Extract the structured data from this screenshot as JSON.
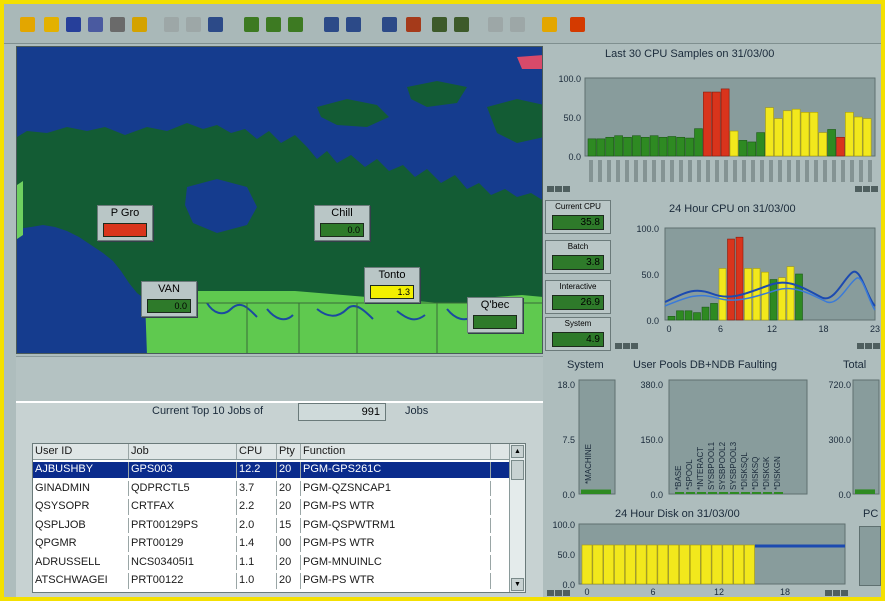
{
  "toolbar": {
    "buttons": [
      {
        "name": "open-folder-icon",
        "color": "#e3a600"
      },
      {
        "name": "folder-icon",
        "color": "#e3b100"
      },
      {
        "name": "save-icon",
        "color": "#263f9a"
      },
      {
        "name": "save-as-icon",
        "color": "#4a5aa0"
      },
      {
        "name": "print-icon",
        "color": "#6a6a6a"
      },
      {
        "name": "exit-door-icon",
        "color": "#d4a200"
      },
      {
        "name": "cut-icon",
        "color": "#888",
        "disabled": true
      },
      {
        "name": "copy-icon",
        "color": "#888",
        "disabled": true
      },
      {
        "name": "paste-icon",
        "color": "#2c4a88"
      },
      {
        "name": "table-icon",
        "color": "#3d7a22"
      },
      {
        "name": "grid-icon",
        "color": "#3d7a22"
      },
      {
        "name": "sheet-icon",
        "color": "#3d7a22"
      },
      {
        "name": "bar-chart-icon",
        "color": "#2c4a88"
      },
      {
        "name": "bar-chart-2-icon",
        "color": "#2c4a88"
      },
      {
        "name": "monitor-icon",
        "color": "#2c4a88"
      },
      {
        "name": "alarm-icon",
        "color": "#a53a1a"
      },
      {
        "name": "document-icon",
        "color": "#3d5a2a"
      },
      {
        "name": "windows-icon",
        "color": "#3d5a2a"
      },
      {
        "name": "tile-icon",
        "color": "#888",
        "disabled": true
      },
      {
        "name": "cascade-icon",
        "color": "#888",
        "disabled": true
      },
      {
        "name": "help-icon",
        "color": "#e3a600"
      },
      {
        "name": "info-icon",
        "color": "#d43a00"
      }
    ]
  },
  "map": {
    "locations": [
      {
        "name": "P Gro",
        "value": "",
        "color": "#d9341c"
      },
      {
        "name": "Chill",
        "value": "0.0",
        "color": "#2e7a2a"
      },
      {
        "name": "VAN",
        "value": "0.0",
        "color": "#2e7a2a"
      },
      {
        "name": "Tonto",
        "value": "1.3",
        "color": "#f2f000"
      },
      {
        "name": "Q'bec",
        "value": "",
        "color": "#2e7a2a"
      }
    ]
  },
  "jobs": {
    "count_label": "Current Top 10 Jobs of",
    "count_value": "991",
    "count_suffix": "Jobs",
    "columns": [
      "User ID",
      "Job",
      "CPU",
      "Pty",
      "Function"
    ],
    "rows": [
      [
        "AJBUSHBY",
        "GPS003",
        "12.2",
        "20",
        "PGM-GPS261C"
      ],
      [
        "GINADMIN",
        "QDPRCTL5",
        "3.7",
        "20",
        "PGM-QZSNCAP1"
      ],
      [
        "QSYSOPR",
        "CRTFAX",
        "2.2",
        "20",
        "PGM-PS  WTR"
      ],
      [
        "QSPLJOB",
        "PRT00129PS",
        "2.0",
        "15",
        "PGM-QSPWTRM1"
      ],
      [
        "QPGMR",
        "PRT00129",
        "1.4",
        "00",
        "PGM-PS  WTR"
      ],
      [
        "ADRUSSELL",
        "NCS03405I1",
        "1.1",
        "20",
        "PGM-MNUINLC"
      ],
      [
        "ATSCHWAGEI",
        "PRT00122",
        "1.0",
        "20",
        "PGM-PS  WTR"
      ]
    ]
  },
  "stats": [
    {
      "name": "Current CPU",
      "value": "35.8"
    },
    {
      "name": "Batch",
      "value": "3.8"
    },
    {
      "name": "Interactive",
      "value": "26.9"
    },
    {
      "name": "System",
      "value": "4.9"
    }
  ],
  "panels": {
    "cpu30_title": "Last 30 CPU Samples on 31/03/00",
    "cpu24_title": "24 Hour CPU on 31/03/00",
    "system_title": "System",
    "pools_title": "User Pools DB+NDB Faulting",
    "total_title": "Total",
    "disk_title": "24 Hour Disk on 31/03/00",
    "pc_title": "PC",
    "system_bar_label": "*MACHINE",
    "pool_labels": [
      "*BASE",
      "*SPOOL",
      "*INTERACT",
      "SYSBPOOL1",
      "SYSBPOOL2",
      "SYSBPOOL3",
      "*DISKSQL",
      "*DISKSQ",
      "*DISKGK",
      "*DISKGN"
    ]
  },
  "chart_data": [
    {
      "type": "bar",
      "title": "Last 30 CPU Samples on 31/03/00",
      "ylim": [
        0,
        100
      ],
      "y_ticks": [
        "100.0",
        "50.0",
        "0.0"
      ],
      "values": [
        22,
        22,
        24,
        26,
        24,
        26,
        24,
        26,
        24,
        25,
        24,
        23,
        35,
        82,
        82,
        86,
        32,
        20,
        18,
        30,
        62,
        48,
        58,
        60,
        56,
        56,
        30,
        34,
        24,
        56,
        50,
        48
      ],
      "colors": [
        "g",
        "g",
        "g",
        "g",
        "g",
        "g",
        "g",
        "g",
        "g",
        "g",
        "g",
        "g",
        "g",
        "r",
        "r",
        "r",
        "y",
        "g",
        "g",
        "g",
        "y",
        "y",
        "y",
        "y",
        "y",
        "y",
        "y",
        "g",
        "r",
        "y",
        "y",
        "y"
      ]
    },
    {
      "type": "bar",
      "title": "24 Hour CPU on 31/03/00",
      "ylim": [
        0,
        100
      ],
      "y_ticks": [
        "100.0",
        "50.0",
        "0.0"
      ],
      "x_ticks": [
        "0",
        "6",
        "12",
        "18",
        "23"
      ],
      "values": [
        4,
        10,
        10,
        8,
        14,
        18,
        56,
        88,
        90,
        56,
        56,
        52,
        44,
        46,
        58,
        50,
        0,
        0,
        0,
        0,
        0,
        0,
        0,
        0
      ],
      "colors": [
        "g",
        "g",
        "g",
        "g",
        "g",
        "g",
        "y",
        "r",
        "r",
        "y",
        "y",
        "y",
        "g",
        "y",
        "y",
        "g",
        "g",
        "g",
        "g",
        "g",
        "g",
        "g",
        "g",
        "g"
      ]
    },
    {
      "type": "bar",
      "title": "System",
      "ylim": [
        0,
        18
      ],
      "y_ticks": [
        "18.0",
        "7.5",
        "0.0"
      ],
      "values": [
        0.4
      ]
    },
    {
      "type": "bar",
      "title": "User Pools DB+NDB Faulting",
      "ylim": [
        0,
        380
      ],
      "y_ticks": [
        "380.0",
        "150.0",
        "0.0"
      ],
      "values": [
        0,
        0,
        0,
        0,
        0,
        0,
        0,
        0,
        0,
        0
      ]
    },
    {
      "type": "bar",
      "title": "Total",
      "ylim": [
        0,
        720
      ],
      "y_ticks": [
        "720.0",
        "300.0",
        "0.0"
      ],
      "values": [
        30
      ]
    },
    {
      "type": "bar",
      "title": "24 Hour Disk on 31/03/00",
      "ylim": [
        0,
        100
      ],
      "y_ticks": [
        "100.0",
        "50.0",
        "0.0"
      ],
      "x_ticks": [
        "0",
        "6",
        "12",
        "18"
      ],
      "values": [
        65,
        65,
        65,
        65,
        65,
        65,
        65,
        65,
        65,
        65,
        65,
        65,
        65,
        65,
        65,
        65,
        0,
        0,
        0,
        0,
        0,
        0,
        0,
        0
      ]
    }
  ]
}
